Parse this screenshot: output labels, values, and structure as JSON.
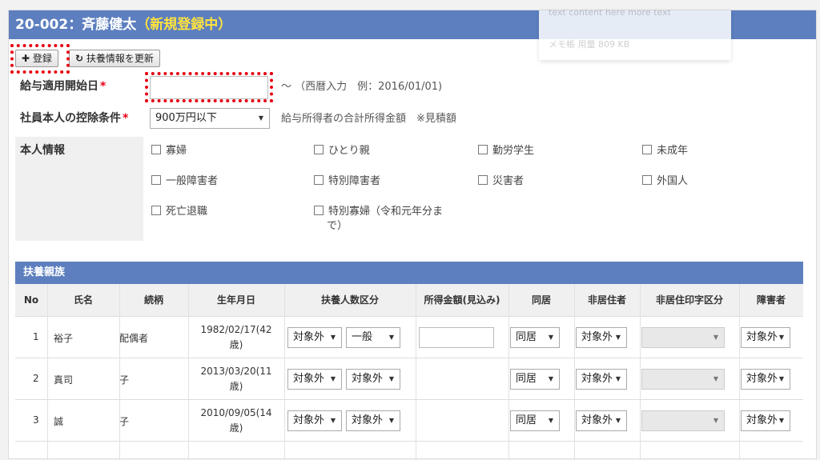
{
  "header": {
    "code_name": "20-002：斉藤健太",
    "status": "（新規登録中）"
  },
  "ghost": {
    "line1": "text content here more text",
    "line2": "メモ帳 用量  809 KB"
  },
  "toolbar": {
    "register_label": "登録",
    "register_icon": "plus-icon",
    "refresh_label": "扶養情報を更新",
    "refresh_icon": "refresh-icon"
  },
  "form": {
    "start_date": {
      "label": "給与適用開始日",
      "required_mark": "*",
      "value": "",
      "hint": "～ （西暦入力　例：2016/01/01)"
    },
    "deduction": {
      "label": "社員本人の控除条件",
      "required_mark": "*",
      "selected": "900万円以下",
      "hint": "給与所得者の合計所得金額　※見積額"
    },
    "personal": {
      "label": "本人情報",
      "options": [
        "寡婦",
        "ひとり親",
        "勤労学生",
        "未成年",
        "一般障害者",
        "特別障害者",
        "災害者",
        "外国人",
        "死亡退職",
        "特別寡婦（令和元年分ま",
        "で）"
      ]
    }
  },
  "dependents": {
    "section_title": "扶養親族",
    "columns": [
      "No",
      "氏名",
      "続柄",
      "生年月日",
      "扶養人数区分",
      "所得金額(見込み)",
      "同居",
      "非居住者",
      "非居住印字区分",
      "障害者"
    ],
    "rows": [
      {
        "no": "1",
        "name": "裕子",
        "relation": "配偶者",
        "birth": "1982/02/17(42",
        "age": "歳)",
        "class1": "対象外",
        "class2": "一般",
        "income": "",
        "cohabit": "同居",
        "nonres": "対象外",
        "nonres_print": "",
        "disabled": "対象外"
      },
      {
        "no": "2",
        "name": "真司",
        "relation": "子",
        "birth": "2013/03/20(11",
        "age": "歳)",
        "class1": "対象外",
        "class2": "対象外",
        "income": "",
        "cohabit": "同居",
        "nonres": "対象外",
        "nonres_print": "",
        "disabled": "対象外"
      },
      {
        "no": "3",
        "name": "誠",
        "relation": "子",
        "birth": "2010/09/05(14",
        "age": "歳)",
        "class1": "対象外",
        "class2": "対象外",
        "income": "",
        "cohabit": "同居",
        "nonres": "対象外",
        "nonres_print": "",
        "disabled": "対象外"
      }
    ]
  },
  "colors": {
    "header_blue": "#5d7fbf",
    "status_yellow": "#ffe33d",
    "required_red": "#e60012",
    "highlight_red": "#e60012"
  }
}
